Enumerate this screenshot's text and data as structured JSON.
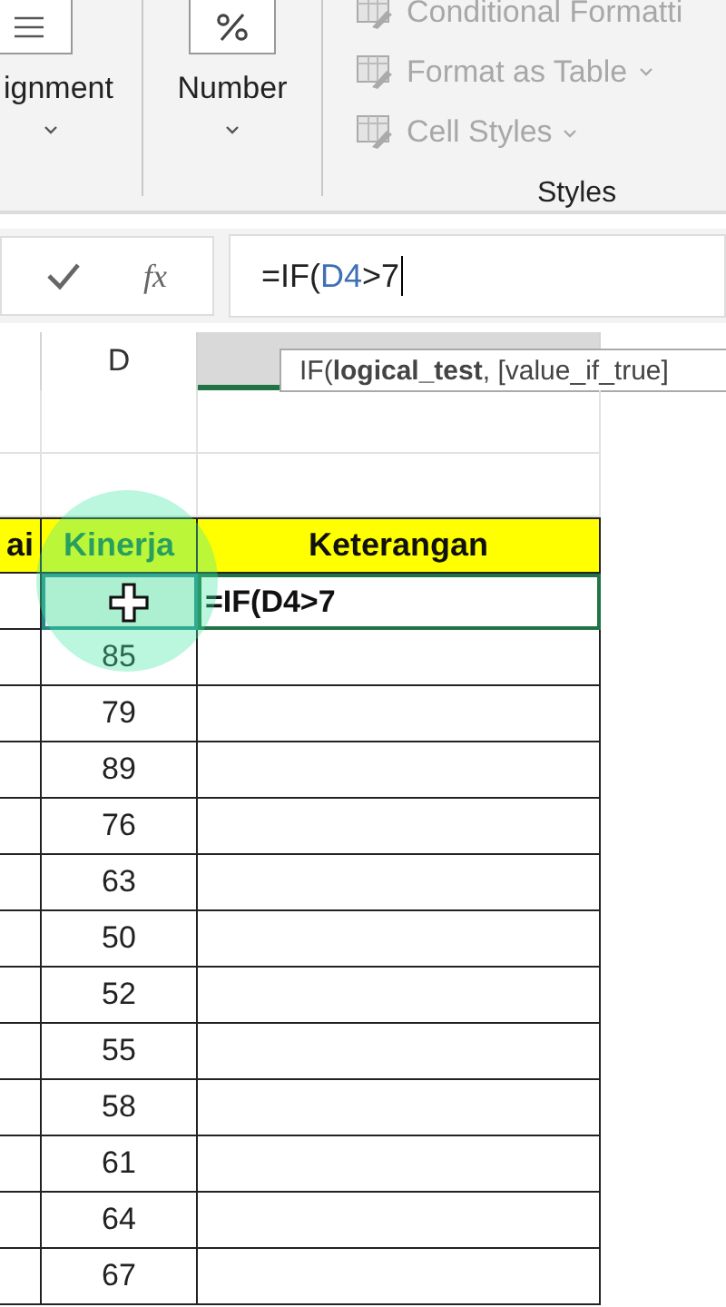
{
  "ribbon": {
    "groups": [
      {
        "label": "ignment"
      },
      {
        "label": "Number"
      }
    ],
    "styles": {
      "items": [
        "Conditional Formatti",
        "Format as Table",
        "Cell Styles"
      ],
      "label": "Styles"
    }
  },
  "formula_bar": {
    "function_button": "fx",
    "parts": [
      {
        "text": "=IF(",
        "kind": "plain"
      },
      {
        "text": "D4",
        "kind": "ref"
      },
      {
        "text": ">7",
        "kind": "plain"
      }
    ],
    "tooltip": "IF(**logical_test**, [value_if_true]"
  },
  "columns": [
    {
      "label": "D",
      "selected": false
    },
    {
      "selected": true
    }
  ],
  "table": {
    "headers": [
      "ai",
      "Kinerja",
      "Keterangan"
    ],
    "rows": [
      {
        "keterangan": "=IF(D4>7",
        "selected": true
      },
      {
        "kinerja": "85",
        "selected": false
      },
      {
        "kinerja": "79",
        "selected": false
      },
      {
        "kinerja": "89",
        "selected": false
      },
      {
        "kinerja": "76",
        "selected": false
      },
      {
        "kinerja": "63",
        "selected": false
      },
      {
        "kinerja": "50",
        "selected": false
      },
      {
        "kinerja": "52",
        "selected": false
      },
      {
        "kinerja": "55",
        "selected": false
      },
      {
        "kinerja": "58",
        "selected": false
      },
      {
        "kinerja": "61",
        "selected": false
      },
      {
        "kinerja": "64",
        "selected": false
      },
      {
        "kinerja": "67",
        "selected": false
      }
    ]
  }
}
